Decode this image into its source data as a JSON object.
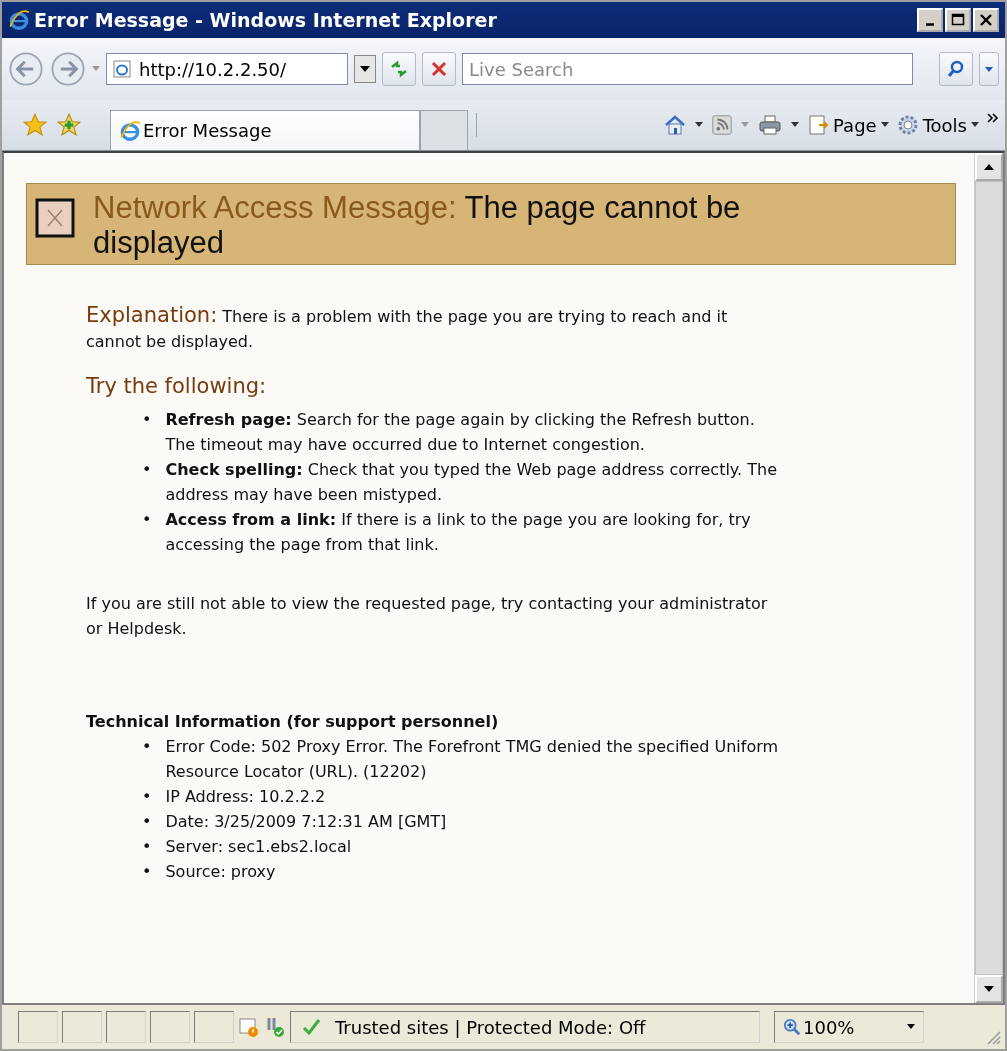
{
  "window": {
    "title": "Error Message - Windows Internet Explorer"
  },
  "address_bar": {
    "url": "http://10.2.2.50/"
  },
  "search": {
    "placeholder": "Live Search"
  },
  "tabs": [
    {
      "label": "Error Message",
      "selected": true
    }
  ],
  "command_bar": [
    {
      "kind": "home"
    },
    {
      "kind": "feeds"
    },
    {
      "kind": "print"
    },
    {
      "kind": "page",
      "label": "Page"
    },
    {
      "kind": "tools",
      "label": "Tools"
    }
  ],
  "page": {
    "banner": {
      "label": "Network Access Message:",
      "text": "The page cannot be displayed"
    },
    "explanation": {
      "label": "Explanation:",
      "text": "There is a problem with the page you are trying to reach and it cannot be displayed."
    },
    "try_heading": "Try the following:",
    "suggestions": [
      {
        "bullet": "•",
        "text": "**Refresh page:** Search for the page again by clicking the Refresh button. The timeout may have occurred due to Internet congestion."
      },
      {
        "bullet": "•",
        "text": "**Check spelling:** Check that you typed the Web page address correctly. The address may have been mistyped."
      },
      {
        "bullet": "•",
        "text": "**Access from a link:** If there is a link to the page you are looking for, try accessing the page from that link."
      }
    ],
    "contact": "If you are still not able to view the requested page, try contacting your administrator or Helpdesk.",
    "technical_heading": "Technical Information (for support personnel)",
    "technical_items": [
      {
        "bullet": "•",
        "text": "Error Code: 502 Proxy Error. The Forefront TMG denied the specified Uniform Resource Locator (URL). (12202)"
      },
      {
        "bullet": "•",
        "text": "IP Address: 10.2.2.2"
      },
      {
        "bullet": "•",
        "text": "Date: 3/25/2009 7:12:31 AM [GMT]"
      },
      {
        "bullet": "•",
        "text": "Server: sec1.ebs2.local"
      },
      {
        "bullet": "•",
        "text": "Source: proxy"
      }
    ]
  },
  "status_bar": {
    "zone": "Trusted sites | Protected Mode: Off",
    "zoom": "100%"
  }
}
